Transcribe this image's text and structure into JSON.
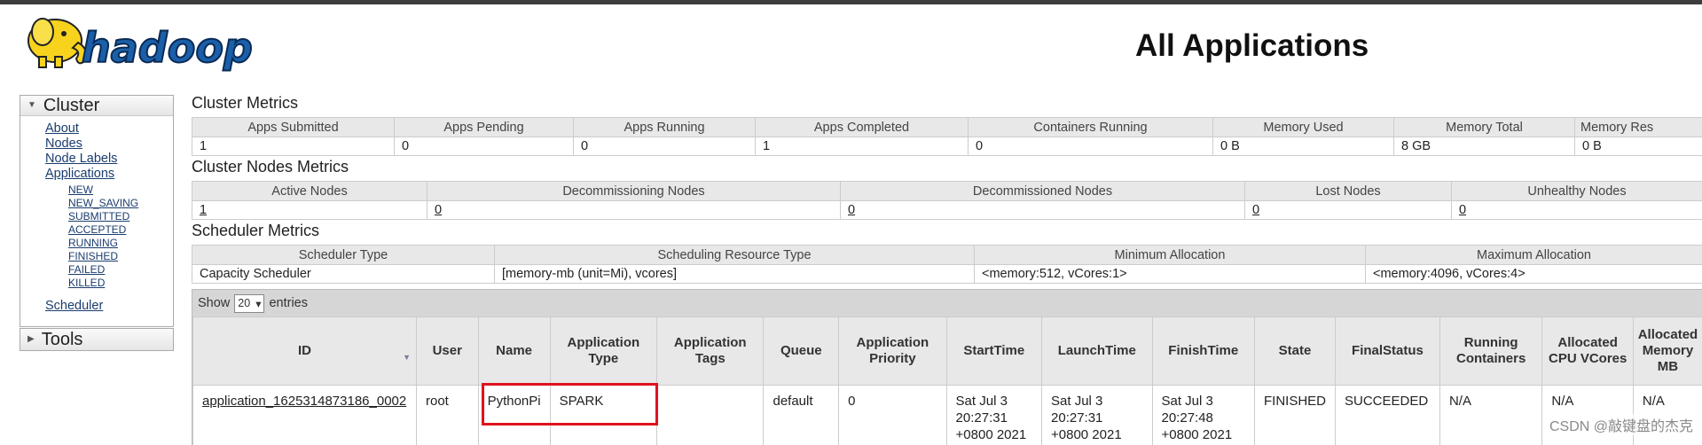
{
  "header": {
    "logo_text": "hadoop",
    "title": "All Applications"
  },
  "sidebar": {
    "cluster_label": "Cluster",
    "links": [
      "About",
      "Nodes",
      "Node Labels",
      "Applications"
    ],
    "app_states": [
      "NEW",
      "NEW_SAVING",
      "SUBMITTED",
      "ACCEPTED",
      "RUNNING",
      "FINISHED",
      "FAILED",
      "KILLED"
    ],
    "scheduler_link": "Scheduler",
    "tools_label": "Tools"
  },
  "cluster_metrics": {
    "title": "Cluster Metrics",
    "headers": [
      "Apps Submitted",
      "Apps Pending",
      "Apps Running",
      "Apps Completed",
      "Containers Running",
      "Memory Used",
      "Memory Total",
      "Memory Res"
    ],
    "values": [
      "1",
      "0",
      "0",
      "1",
      "0",
      "0 B",
      "8 GB",
      "0 B"
    ]
  },
  "cluster_nodes_metrics": {
    "title": "Cluster Nodes Metrics",
    "headers": [
      "Active Nodes",
      "Decommissioning Nodes",
      "Decommissioned Nodes",
      "Lost Nodes",
      "Unhealthy Nodes"
    ],
    "values": [
      "1",
      "0",
      "0",
      "0",
      "0"
    ]
  },
  "scheduler_metrics": {
    "title": "Scheduler Metrics",
    "headers": [
      "Scheduler Type",
      "Scheduling Resource Type",
      "Minimum Allocation",
      "Maximum Allocation"
    ],
    "values": [
      "Capacity Scheduler",
      "[memory-mb (unit=Mi), vcores]",
      "<memory:512, vCores:1>",
      "<memory:4096, vCores:4>"
    ]
  },
  "apps_table": {
    "show_label": "Show",
    "page_length": "20",
    "entries_label": "entries",
    "columns": [
      "ID",
      "User",
      "Name",
      "Application Type",
      "Application Tags",
      "Queue",
      "Application Priority",
      "StartTime",
      "LaunchTime",
      "FinishTime",
      "State",
      "FinalStatus",
      "Running Containers",
      "Allocated CPU VCores",
      "Allocated Memory MB"
    ],
    "rows": [
      {
        "id": "application_1625314873186_0002",
        "user": "root",
        "name": "PythonPi",
        "type": "SPARK",
        "tags": "",
        "queue": "default",
        "priority": "0",
        "start_time": "Sat Jul 3 20:27:31 +0800 2021",
        "launch_time": "Sat Jul 3 20:27:31 +0800 2021",
        "finish_time": "Sat Jul 3 20:27:48 +0800 2021",
        "state": "FINISHED",
        "final_status": "SUCCEEDED",
        "running_containers": "N/A",
        "allocated_vcores": "N/A",
        "allocated_memory": "N/A"
      }
    ]
  },
  "watermark": "CSDN @敲键盘的杰克",
  "colors": {
    "highlight_box": "#e0121e",
    "link": "#1a3c6e",
    "header_bg": "#e8e8e8",
    "logo_yellow": "#f7d31e"
  }
}
